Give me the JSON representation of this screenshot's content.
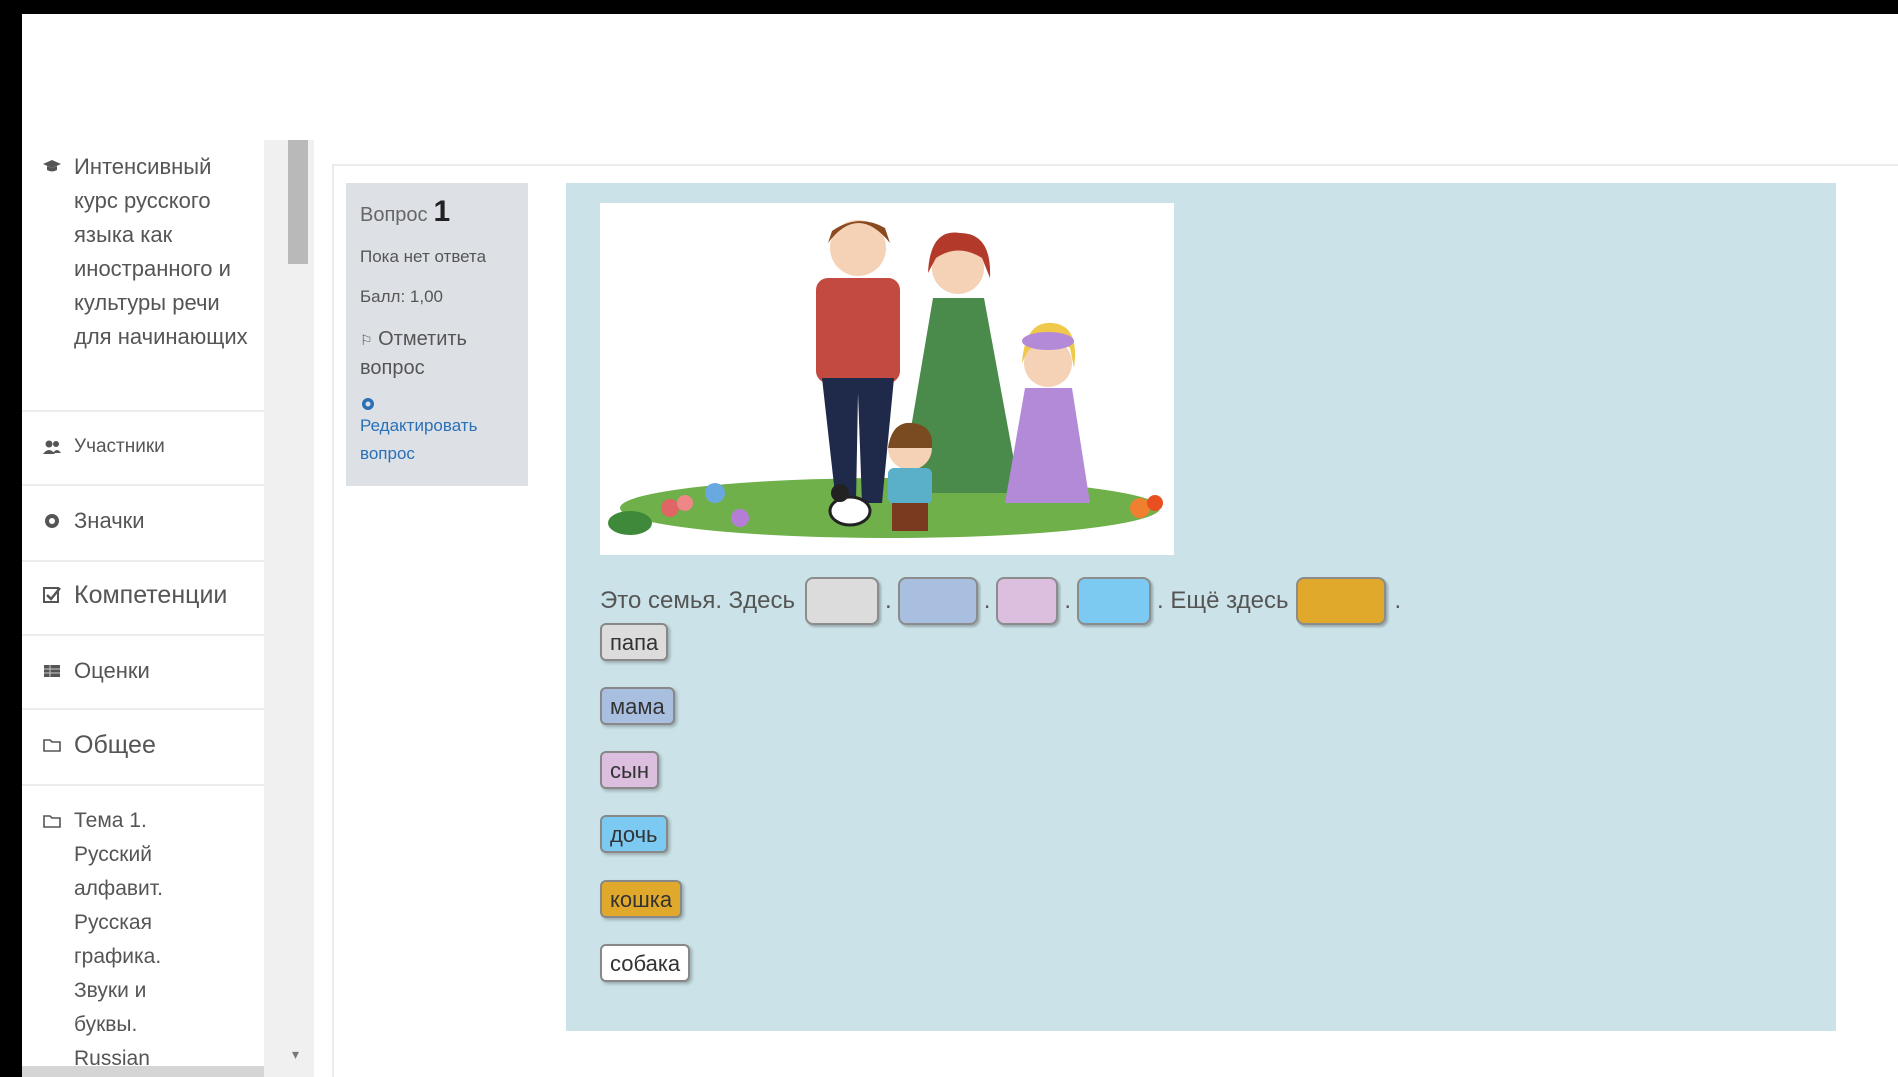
{
  "sidebar": {
    "items": [
      {
        "icon": "graduation-cap-icon",
        "label": "Интенсивный курс русского языка как иностранного и культуры речи для начинающих"
      },
      {
        "icon": "users-icon",
        "label": "Участники"
      },
      {
        "icon": "badge-icon",
        "label": "Значки"
      },
      {
        "icon": "checkbox-icon",
        "label": "Компетенции"
      },
      {
        "icon": "table-icon",
        "label": "Оценки"
      },
      {
        "icon": "folder-icon",
        "label": "Общее"
      },
      {
        "icon": "folder-icon",
        "label": "Тема 1. Русский алфавит. Русская графика. Звуки и буквы. Russian"
      }
    ]
  },
  "question_info": {
    "question_prefix": "Вопрос",
    "question_number": "1",
    "status": "Пока нет ответа",
    "mark": "Балл: 1,00",
    "flag_label": "Отметить вопрос",
    "edit_label": "Редактировать вопрос"
  },
  "question": {
    "sentence_start": "Это семья. Здесь",
    "sentence_mid": ". Ещё здесь",
    "sentence_end": ".",
    "drop_zones": [
      {
        "color": "#dcdcdc"
      },
      {
        "color": "#a9bfe0"
      },
      {
        "color": "#dcbedf"
      },
      {
        "color": "#7ccaf2"
      },
      {
        "color": "#e1a92c"
      }
    ],
    "choices": [
      {
        "label": "папа",
        "color": "#dcdcdc"
      },
      {
        "label": "мама",
        "color": "#a9bfe0"
      },
      {
        "label": "сын",
        "color": "#dcbedf"
      },
      {
        "label": "дочь",
        "color": "#7ccaf2"
      },
      {
        "label": "кошка",
        "color": "#e1a92c"
      },
      {
        "label": "собака",
        "color": "#ffffff"
      }
    ]
  }
}
